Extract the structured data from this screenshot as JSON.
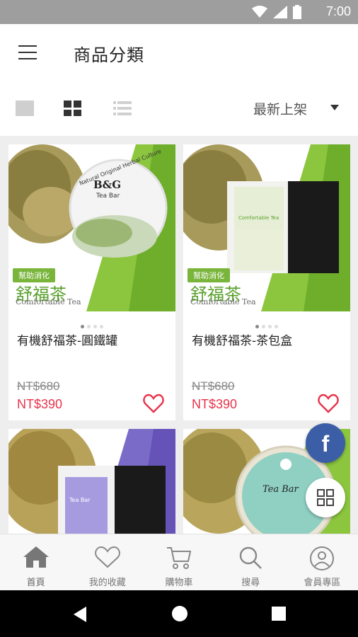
{
  "status_bar": {
    "time": "7:00"
  },
  "header": {
    "title": "商品分類"
  },
  "toolbar": {
    "sort_label": "最新上架"
  },
  "products": [
    {
      "name": "有機舒福茶-圓鐵罐",
      "old_price": "NT$680",
      "price": "NT$390",
      "badge": "幫助消化",
      "image_title": "舒福茶",
      "image_subtitle": "Comfortable Tea",
      "brand": "B&G",
      "brand_line": "Tea Bar",
      "arc_text": "Natural Original Herbal Culture"
    },
    {
      "name": "有機舒福茶-茶包盒",
      "old_price": "NT$680",
      "price": "NT$390",
      "badge": "幫助消化",
      "image_title": "舒福茶",
      "image_subtitle": "Comfortable Tea",
      "box_label": "Comfortable Tea"
    },
    {
      "box_label": "Tea Bar"
    },
    {
      "tin_label": "Tea Bar"
    }
  ],
  "bottom_nav": [
    {
      "label": "首頁",
      "icon": "home-icon"
    },
    {
      "label": "我的收藏",
      "icon": "heart-icon"
    },
    {
      "label": "購物車",
      "icon": "cart-icon"
    },
    {
      "label": "搜尋",
      "icon": "search-icon"
    },
    {
      "label": "會員專區",
      "icon": "user-icon"
    }
  ],
  "fab": {
    "facebook": "f"
  },
  "colors": {
    "price": "#e8334a",
    "accent_green": "#79b53b",
    "facebook": "#3b5ea7"
  }
}
